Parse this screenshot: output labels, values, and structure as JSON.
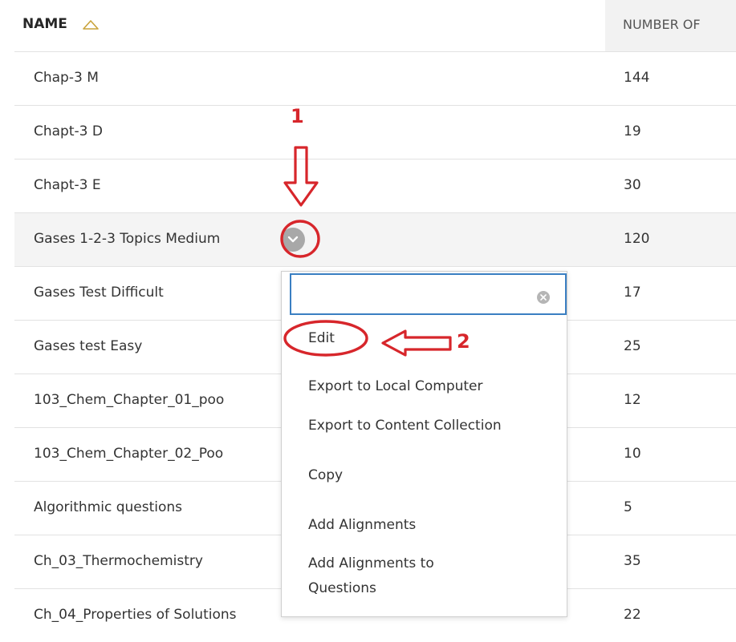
{
  "header": {
    "name_label": "NAME",
    "number_label": "NUMBER OF"
  },
  "rows": [
    {
      "name": "Chap-3 M",
      "count": "144"
    },
    {
      "name": "Chapt-3 D",
      "count": "19"
    },
    {
      "name": "Chapt-3 E",
      "count": "30"
    },
    {
      "name": "Gases 1-2-3 Topics Medium",
      "count": "120"
    },
    {
      "name": "Gases Test Difficult",
      "count": "17"
    },
    {
      "name": "Gases test Easy",
      "count": "25"
    },
    {
      "name": "103_Chem_Chapter_01_poo",
      "count": "12"
    },
    {
      "name": "103_Chem_Chapter_02_Poo",
      "count": "10"
    },
    {
      "name": "Algorithmic questions",
      "count": "5"
    },
    {
      "name": "Ch_03_Thermochemistry",
      "count": "35"
    },
    {
      "name": "Ch_04_Properties of Solutions",
      "count": "22"
    }
  ],
  "menu": {
    "search_value": "",
    "items": [
      "Edit",
      "Export to Local Computer",
      "Export to Content Collection",
      "Copy",
      "Add Alignments",
      "Add Alignments to",
      "Questions"
    ]
  },
  "annotations": {
    "step1": "1",
    "step2": "2"
  },
  "colors": {
    "annotation": "#d7262b",
    "menu_focus": "#3a7fc2",
    "header_bg": "#f2f2f2",
    "highlight_row": "#f4f4f4"
  },
  "icons": {
    "sort": "sort-ascending-icon",
    "options": "chevron-down-icon",
    "clear": "clear-search-icon"
  }
}
